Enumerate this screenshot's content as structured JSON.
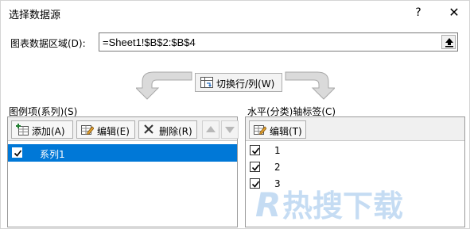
{
  "dialog": {
    "title": "选择数据源",
    "help": "?",
    "close": "✕"
  },
  "range": {
    "label": "图表数据区域(D):",
    "value": "=Sheet1!$B$2:$B$4"
  },
  "switch_button": "切换行/列(W)",
  "legend": {
    "label": "图例项(系列)(S)",
    "add_label": "添加(A)",
    "edit_label": "编辑(E)",
    "delete_label": "删除(R)",
    "items": [
      {
        "label": "系列1",
        "checked": true,
        "selected": true
      }
    ]
  },
  "axis": {
    "label": "水平(分类)轴标签(C)",
    "edit_label": "编辑(T)",
    "items": [
      {
        "label": "1",
        "checked": true
      },
      {
        "label": "2",
        "checked": true
      },
      {
        "label": "3",
        "checked": true
      }
    ]
  },
  "watermark": {
    "text": "R热搜下载"
  },
  "colors": {
    "selection": "#0078d7",
    "watermark": "#bcd7f2"
  }
}
